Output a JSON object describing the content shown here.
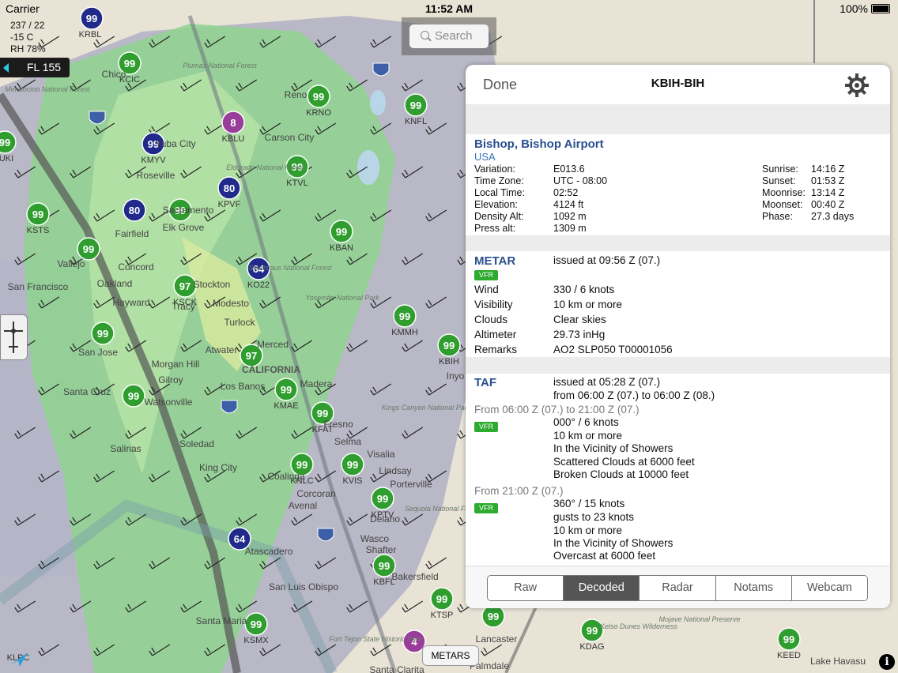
{
  "status_bar": {
    "carrier": "Carrier",
    "time": "11:52 AM",
    "battery": "100%"
  },
  "map": {
    "weather_info": [
      "237 / 22",
      "-15 C",
      "RH 78%"
    ],
    "flight_level": "FL 155",
    "search_placeholder": "Search",
    "metars_button": "METARS",
    "place_labels": [
      "Chico",
      "Yuba City",
      "Roseville",
      "Sacramento",
      "Elk Grove",
      "Fairfield",
      "Concord",
      "Oakland",
      "San Francisco",
      "Hayward",
      "Stockton",
      "Modesto",
      "Vallejo",
      "Tracy",
      "Turlock",
      "Merced",
      "San Jose",
      "Morgan Hill",
      "Gilroy",
      "Los Banos",
      "Atwater",
      "Santa Cruz",
      "Watsonville",
      "Salinas",
      "Madera",
      "Fresno",
      "Soledad",
      "Selma",
      "Visalia",
      "King City",
      "Coalinga",
      "Corcoran",
      "Porterville",
      "Lindsay",
      "Avenal",
      "Delano",
      "Wasco",
      "Shafter",
      "Bakersfield",
      "Atascadero",
      "San Luis Obispo",
      "Santa Maria",
      "Lancaster",
      "Palmdale",
      "Santa Clarita",
      "Carson City",
      "Reno",
      "Kings Canyon National Park",
      "Sequoia National Forest",
      "Stanislaus National Forest",
      "Eldorado National Forest",
      "Plumas National Forest",
      "Mendocino National Forest",
      "Yosemite National Park",
      "Inyo",
      "CALIFORNIA",
      "Lake Havasu",
      "Kelso Dunes Wilderness",
      "Mojave National Preserve",
      "Fort Tejon State Historic Park"
    ],
    "stations": [
      {
        "id": "KRBL",
        "val": "99",
        "kind": "blue"
      },
      {
        "id": "KCIC",
        "val": "99",
        "kind": "green"
      },
      {
        "id": "KMYV",
        "val": "99",
        "kind": "blue"
      },
      {
        "id": "KBLU",
        "val": "8",
        "kind": "purple"
      },
      {
        "id": "KRNO",
        "val": "99",
        "kind": "green"
      },
      {
        "id": "KNFL",
        "val": "99",
        "kind": "green"
      },
      {
        "id": "KTVL",
        "val": "99",
        "kind": "green"
      },
      {
        "id": "KPVF",
        "val": "80",
        "kind": "blue"
      },
      {
        "id": "KEDU",
        "val": "80",
        "kind": "blue"
      },
      {
        "id": "KMCC",
        "val": "99",
        "kind": "green"
      },
      {
        "id": "KSTS",
        "val": "99",
        "kind": "green"
      },
      {
        "id": "KAPC",
        "val": "99",
        "kind": "green"
      },
      {
        "id": "KBAN",
        "val": "99",
        "kind": "green"
      },
      {
        "id": "KO22",
        "val": "64",
        "kind": "blue"
      },
      {
        "id": "KSCK",
        "val": "97",
        "kind": "green"
      },
      {
        "id": "KMMH",
        "val": "99",
        "kind": "green"
      },
      {
        "id": "KBIH",
        "val": "99",
        "kind": "green"
      },
      {
        "id": "KRHV",
        "val": "99",
        "kind": "green"
      },
      {
        "id": "KMCE",
        "val": "97",
        "kind": "green"
      },
      {
        "id": "KMAE",
        "val": "99",
        "kind": "green"
      },
      {
        "id": "KWVI",
        "val": "99",
        "kind": "green"
      },
      {
        "id": "KFAT",
        "val": "99",
        "kind": "green"
      },
      {
        "id": "KNLC",
        "val": "99",
        "kind": "green"
      },
      {
        "id": "KVIS",
        "val": "99",
        "kind": "green"
      },
      {
        "id": "KPTV",
        "val": "99",
        "kind": "green"
      },
      {
        "id": "KPRB",
        "val": "64",
        "kind": "blue"
      },
      {
        "id": "KBFL",
        "val": "99",
        "kind": "green"
      },
      {
        "id": "KSMX",
        "val": "99",
        "kind": "green"
      },
      {
        "id": "KTSP",
        "val": "99",
        "kind": "green"
      },
      {
        "id": "KSDB",
        "val": "4",
        "kind": "purple"
      },
      {
        "id": "KWJF",
        "val": "99",
        "kind": "green"
      },
      {
        "id": "KDAG",
        "val": "99",
        "kind": "green"
      },
      {
        "id": "KEED",
        "val": "99",
        "kind": "green"
      },
      {
        "id": "KUKI",
        "val": "99",
        "kind": "green"
      }
    ],
    "station_labels": [
      "KRBL",
      "KCIC",
      "KMYV",
      "KBLU",
      "KRNO",
      "KNFL",
      "KTVL",
      "KPVF",
      "KSTS",
      "KBAN",
      "KO22",
      "KSCK",
      "KMMH",
      "KBIH",
      "KMAE",
      "KFAT",
      "KNLC",
      "KVIS",
      "KPTV",
      "KBFL",
      "KTSP",
      "KSMX",
      "KDAG",
      "KEED",
      "UKI",
      "KLPC"
    ]
  },
  "panel": {
    "done_label": "Done",
    "title": "KBIH-BIH",
    "airport": {
      "name": "Bishop, Bishop Airport",
      "country": "USA",
      "left": [
        {
          "k": "Variation:",
          "v": "E013.6"
        },
        {
          "k": "Time Zone:",
          "v": "UTC - 08:00"
        },
        {
          "k": "Local Time:",
          "v": "02:52"
        },
        {
          "k": "Elevation:",
          "v": "4124 ft"
        },
        {
          "k": "Density Alt:",
          "v": "1092 m"
        },
        {
          "k": "Press alt:",
          "v": "1309 m"
        }
      ],
      "right": [
        {
          "k": "Sunrise:",
          "v": "14:16 Z"
        },
        {
          "k": "Sunset:",
          "v": "01:53 Z"
        },
        {
          "k": "Moonrise:",
          "v": "13:14 Z"
        },
        {
          "k": "Moonset:",
          "v": "00:40 Z"
        },
        {
          "k": "Phase:",
          "v": "27.3 days"
        }
      ]
    },
    "metar": {
      "title": "METAR",
      "issued": "issued at 09:56 Z (07.)",
      "flight_rule": "VFR",
      "rows": [
        {
          "k": "Wind",
          "v": "330 / 6 knots"
        },
        {
          "k": "Visibility",
          "v": "10 km or more"
        },
        {
          "k": "Clouds",
          "v": "Clear skies"
        },
        {
          "k": "Altimeter",
          "v": "29.73 inHg"
        },
        {
          "k": "Remarks",
          "v": "AO2 SLP050 T00001056"
        }
      ]
    },
    "taf": {
      "title": "TAF",
      "issued": "issued at 05:28 Z (07.)",
      "validity": "from 06:00 Z (07.) to 06:00 Z (08.)",
      "periods": [
        {
          "from": "From 06:00 Z (07.) to 21:00 Z (07.)",
          "rule": "VFR",
          "lines": [
            "000° / 6 knots",
            "10 km or more",
            "In the Vicinity of Showers",
            "Scattered Clouds at 6000 feet",
            "Broken Clouds at 10000 feet"
          ]
        },
        {
          "from": "From 21:00 Z (07.)",
          "rule": "VFR",
          "lines": [
            "360° / 15 knots",
            "gusts to 23 knots",
            "10 km or more",
            "In the Vicinity of Showers",
            "Overcast at 6000 feet"
          ]
        }
      ]
    },
    "tabs": [
      {
        "label": "Raw",
        "active": false
      },
      {
        "label": "Decoded",
        "active": true
      },
      {
        "label": "Radar",
        "active": false
      },
      {
        "label": "Notams",
        "active": false
      },
      {
        "label": "Webcam",
        "active": false
      }
    ]
  },
  "colors": {
    "station_green": "#2f9e2f",
    "station_blue": "#1f2a8a",
    "station_purple": "#9a3c9a",
    "radar_green": "#8fd48f",
    "radar_grey": "#a9a9b8",
    "accent_title": "#2a4f8f",
    "vfr": "#2eaa2e"
  }
}
